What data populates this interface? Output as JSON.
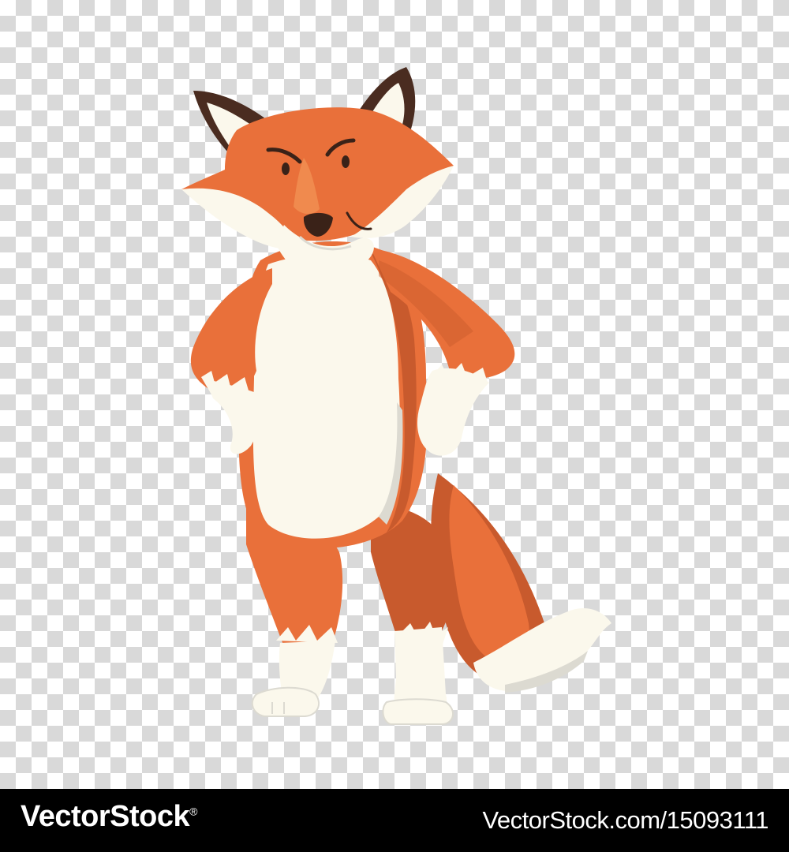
{
  "illustration": {
    "subject_icon": "fox-character-icon",
    "colors": {
      "fur_orange": "#e9703a",
      "fur_orange_dark": "#c85a2d",
      "belly_cream": "#fbf8ec",
      "cream_shade": "#dcdad1",
      "ear_dark": "#4a2c20",
      "outline_dark": "#3a2218",
      "checker_light": "#ffffff",
      "checker_dark": "#d9d9d9"
    }
  },
  "watermark": {
    "brand": "VectorStock",
    "registered_mark": "®",
    "image_url": "VectorStock.com/15093111"
  }
}
